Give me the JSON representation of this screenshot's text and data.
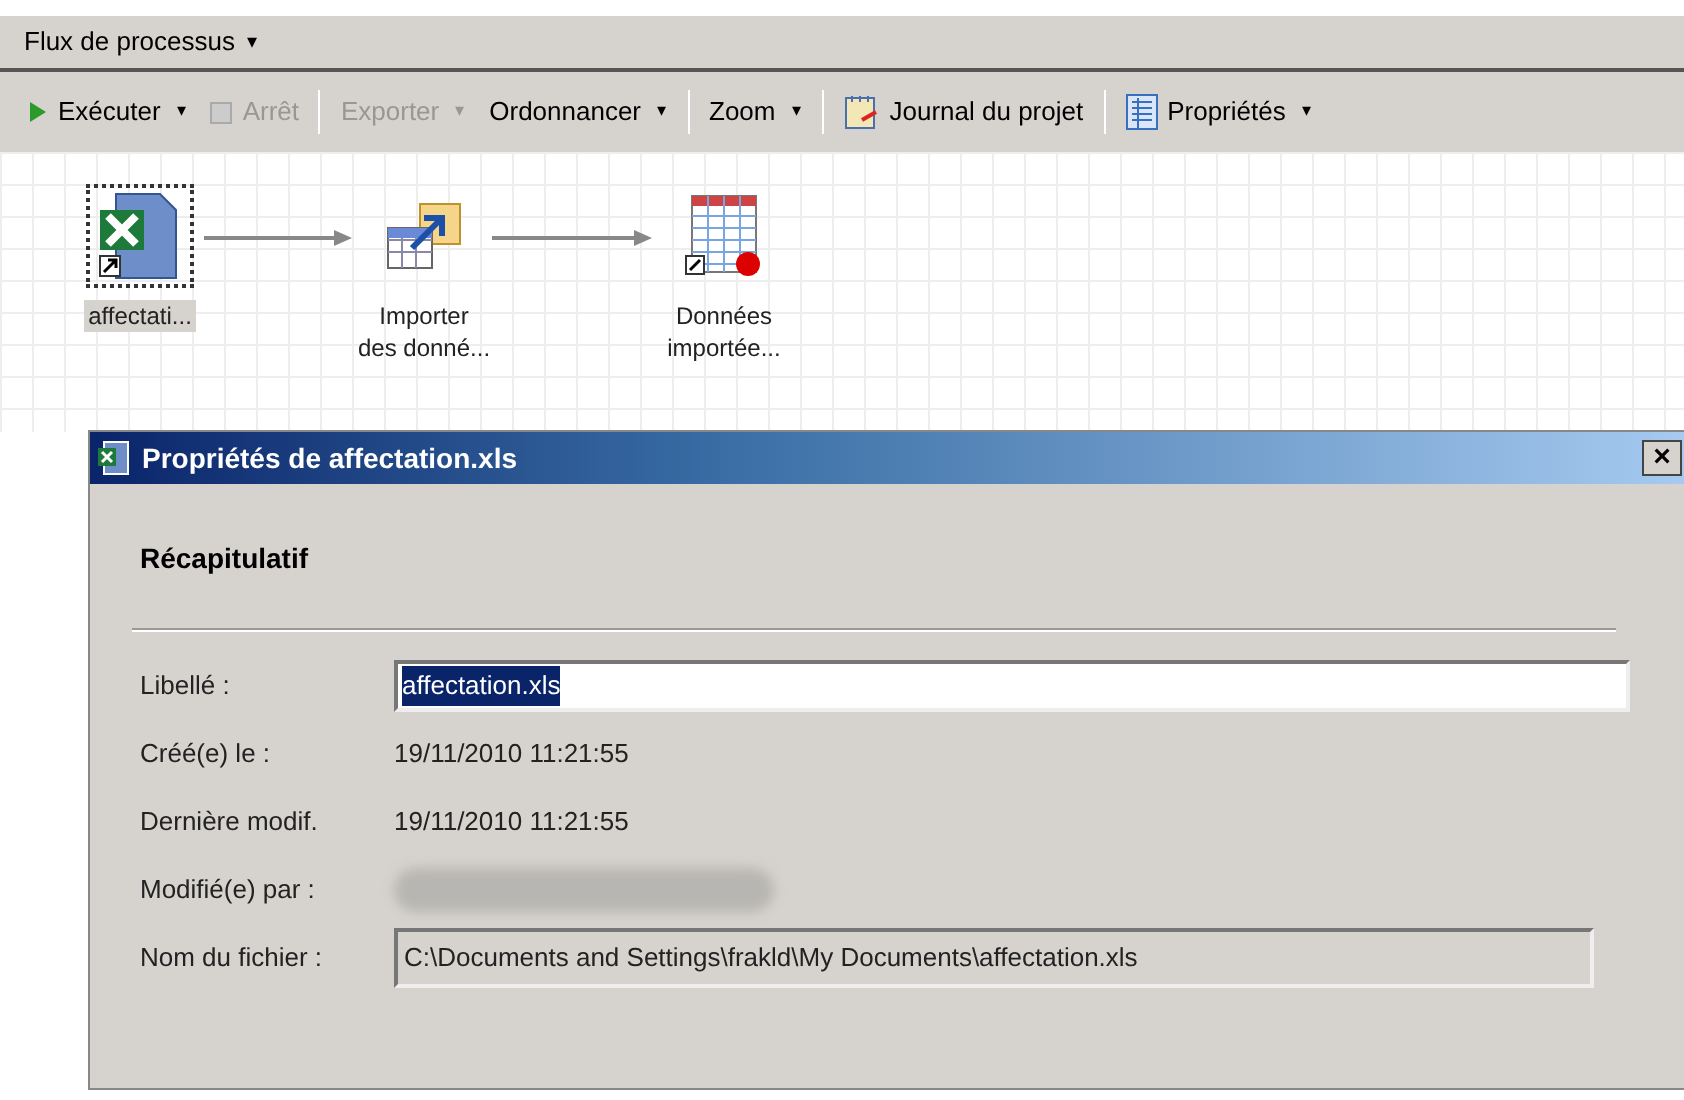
{
  "header": {
    "title": "Flux de processus",
    "dropdown": "▾"
  },
  "toolbar": [
    {
      "kind": "run",
      "label": "Exécuter",
      "dropdown": "▾",
      "disabled": false
    },
    {
      "kind": "stop",
      "label": "Arrêt",
      "disabled": true
    },
    {
      "kind": "separator"
    },
    {
      "kind": "menu",
      "label": "Exporter",
      "dropdown": "▾",
      "disabled": true
    },
    {
      "kind": "menu",
      "label": "Ordonnancer",
      "dropdown": "▾",
      "disabled": false
    },
    {
      "kind": "separator"
    },
    {
      "kind": "menu",
      "label": "Zoom",
      "dropdown": "▾",
      "disabled": false
    },
    {
      "kind": "separator"
    },
    {
      "kind": "log",
      "label": "Journal du projet",
      "disabled": false
    },
    {
      "kind": "separator"
    },
    {
      "kind": "props",
      "label": "Propriétés",
      "dropdown": "▾",
      "disabled": false
    }
  ],
  "flow": {
    "nodes": [
      {
        "kind": "excel",
        "lines": [
          "affectati..."
        ],
        "selected": true
      },
      {
        "kind": "import",
        "lines": [
          "Importer",
          "des donné..."
        ],
        "selected": false
      },
      {
        "kind": "table",
        "lines": [
          "Données",
          "importée..."
        ],
        "selected": false
      }
    ]
  },
  "dialog": {
    "title": "Propriétés de affectation.xls",
    "close": "×",
    "section": "Récapitulatif",
    "rows": [
      {
        "kind": "input",
        "label": "Libellé :",
        "value": "affectation.xls",
        "selected": true
      },
      {
        "kind": "text",
        "label": "Créé(e) le :",
        "value": "19/11/2010 11:21:55"
      },
      {
        "kind": "text",
        "label": "Dernière modif.",
        "value": "19/11/2010 11:21:55"
      },
      {
        "kind": "redacted",
        "label": "Modifié(e) par :"
      },
      {
        "kind": "readonly",
        "label": "Nom du fichier :",
        "value": "C:\\Documents and Settings\\frakld\\My Documents\\affectation.xls"
      }
    ]
  }
}
